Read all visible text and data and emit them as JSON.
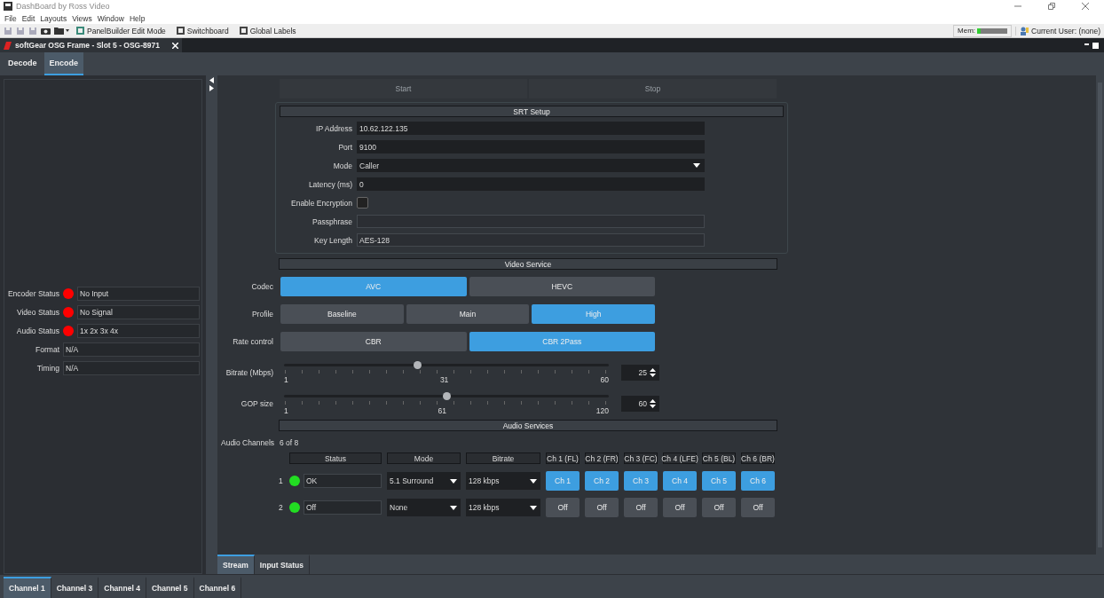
{
  "window": {
    "title": "DashBoard by Ross Video"
  },
  "menu": [
    "File",
    "Edit",
    "Layouts",
    "Views",
    "Window",
    "Help"
  ],
  "toolbar": {
    "buttons": [
      "PanelBuilder Edit Mode",
      "Switchboard",
      "Global Labels"
    ],
    "mem": {
      "label": "Mem:",
      "level": 0.12
    },
    "user": "Current User: (none)"
  },
  "document_tab": {
    "title": "softGear OSG Frame - Slot 5 - OSG-8971"
  },
  "panel_tabs": [
    {
      "label": "Decode",
      "selected": false
    },
    {
      "label": "Encode",
      "selected": true
    }
  ],
  "status": [
    {
      "label": "Encoder Status",
      "kind": "dot",
      "color": "#ff0000",
      "value": "No Input"
    },
    {
      "label": "Video Status",
      "kind": "dot",
      "color": "#ff0000",
      "value": "No Signal"
    },
    {
      "label": "Audio Status",
      "kind": "dot",
      "color": "#ff0000",
      "value": "1x 2x 3x 4x"
    },
    {
      "label": "Format",
      "kind": "plain",
      "value": "N/A"
    },
    {
      "label": "Timing",
      "kind": "plain",
      "value": "N/A"
    }
  ],
  "stream_buttons": [
    {
      "label": "Start",
      "disabled": true
    },
    {
      "label": "Stop",
      "disabled": true
    }
  ],
  "srt": {
    "title": "SRT Setup",
    "fields": [
      {
        "label": "IP Address",
        "kind": "text",
        "value": "10.62.122.135"
      },
      {
        "label": "Port",
        "kind": "text",
        "value": "9100"
      },
      {
        "label": "Mode",
        "kind": "select",
        "value": "Caller"
      },
      {
        "label": "Latency (ms)",
        "kind": "text",
        "value": "0"
      },
      {
        "label": "Enable Encryption",
        "kind": "checkbox",
        "checked": false
      },
      {
        "label": "Passphrase",
        "kind": "text",
        "disabled": true
      },
      {
        "label": "Key Length",
        "kind": "text",
        "value": "AES-128",
        "disabled": true
      }
    ]
  },
  "video": {
    "title": "Video Service",
    "choices": [
      {
        "label": "Codec",
        "options": [
          {
            "label": "AVC",
            "selected": true
          },
          {
            "label": "HEVC",
            "selected": false
          }
        ]
      },
      {
        "label": "Profile",
        "options": [
          {
            "label": "Baseline",
            "selected": false
          },
          {
            "label": "Main",
            "selected": false
          },
          {
            "label": "High",
            "selected": true
          }
        ]
      },
      {
        "label": "Rate control",
        "options": [
          {
            "label": "CBR",
            "selected": false
          },
          {
            "label": "CBR 2Pass",
            "selected": true
          }
        ]
      }
    ],
    "sliders": [
      {
        "label": "Bitrate (Mbps)",
        "min": "1",
        "mid": "31",
        "max": "60",
        "level": 0.41,
        "value": "25"
      },
      {
        "label": "GOP size",
        "min": "1",
        "mid": "61",
        "max": "120",
        "level": 0.5,
        "value": "60"
      }
    ]
  },
  "audio": {
    "title": "Audio Services",
    "channels_label": "Audio Channels",
    "channels_value": "6 of 8",
    "columns": [
      "Status",
      "Mode",
      "Bitrate"
    ],
    "channel_columns": [
      "Ch 1 (FL)",
      "Ch 2 (FR)",
      "Ch 3 (FC)",
      "Ch 4 (LFE)",
      "Ch 5 (BL)",
      "Ch 6 (BR)"
    ],
    "rows": [
      {
        "number": "1",
        "color": "#22dd22",
        "status": "OK",
        "mode": "5.1 Surround",
        "bitrate": "128 kbps",
        "channels": [
          {
            "label": "Ch 1",
            "on": true
          },
          {
            "label": "Ch 2",
            "on": true
          },
          {
            "label": "Ch 3",
            "on": true
          },
          {
            "label": "Ch 4",
            "on": true
          },
          {
            "label": "Ch 5",
            "on": true
          },
          {
            "label": "Ch 6",
            "on": true
          }
        ]
      },
      {
        "number": "2",
        "color": "#22dd22",
        "status": "Off",
        "mode": "None",
        "bitrate": "128 kbps",
        "channels": [
          {
            "label": "Off",
            "on": false
          },
          {
            "label": "Off",
            "on": false
          },
          {
            "label": "Off",
            "on": false
          },
          {
            "label": "Off",
            "on": false
          },
          {
            "label": "Off",
            "on": false
          },
          {
            "label": "Off",
            "on": false
          }
        ]
      }
    ]
  },
  "inner_tabs": [
    {
      "label": "Stream",
      "selected": true
    },
    {
      "label": "Input Status",
      "selected": false
    }
  ],
  "channel_tabs": [
    {
      "label": "Channel 1",
      "selected": true
    },
    {
      "label": "Channel 3",
      "selected": false
    },
    {
      "label": "Channel 4",
      "selected": false
    },
    {
      "label": "Channel 5",
      "selected": false
    },
    {
      "label": "Channel 6",
      "selected": false
    }
  ]
}
